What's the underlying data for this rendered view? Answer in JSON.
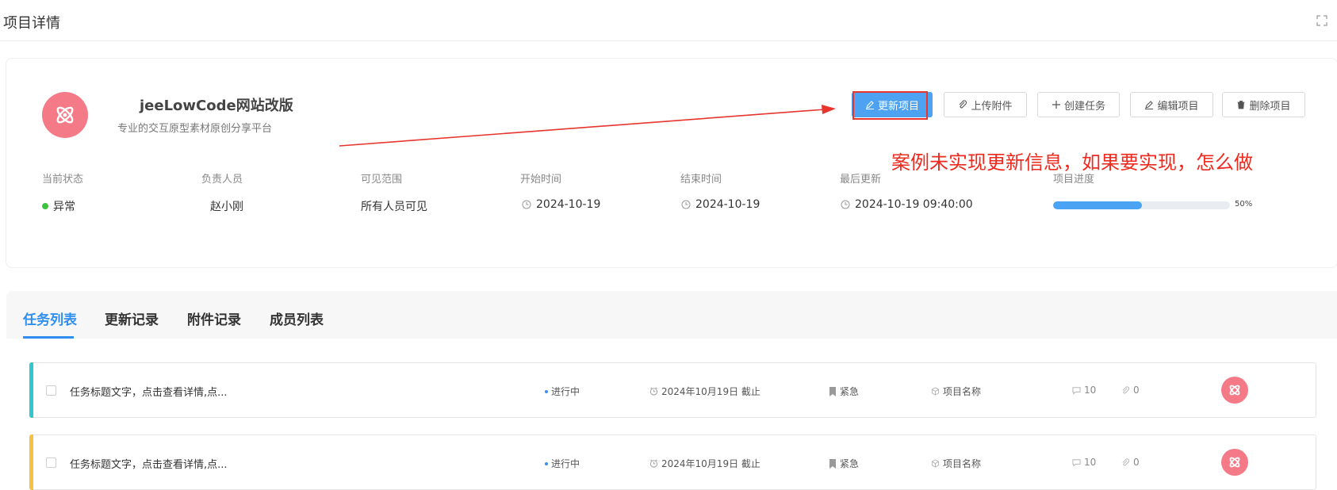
{
  "header": {
    "title": "项目详情",
    "fullscreen_icon": "fullscreen-icon"
  },
  "project": {
    "logo_icon": "atom-icon",
    "name": "jeeLowCode网站改版",
    "description": "专业的交互原型素材原创分享平台",
    "logo_color": "#f47a87"
  },
  "actions": [
    {
      "label": "更新项目",
      "icon": "pencil-icon"
    },
    {
      "label": "上传附件",
      "icon": "paperclip-icon"
    },
    {
      "label": "创建任务",
      "icon": "plus-icon"
    },
    {
      "label": "编辑项目",
      "icon": "pencil-icon"
    },
    {
      "label": "删除项目",
      "icon": "trash-icon"
    }
  ],
  "annotation": {
    "text": "案例未实现更新信息，如果要实现，怎么做",
    "color": "#ee2a1f"
  },
  "meta": {
    "status": {
      "label": "当前状态",
      "value": "异常",
      "dot_color": "#3fc23f"
    },
    "owner": {
      "label": "负责人员",
      "value": "赵小刚"
    },
    "visibility": {
      "label": "可见范围",
      "value": "所有人员可见"
    },
    "start": {
      "label": "开始时间",
      "value": "2024-10-19"
    },
    "end": {
      "label": "结束时间",
      "value": "2024-10-19"
    },
    "updated": {
      "label": "最后更新",
      "value": "2024-10-19 09:40:00"
    },
    "progress": {
      "label": "项目进度",
      "value": 50,
      "text": "50%"
    }
  },
  "tabs": [
    {
      "label": "任务列表",
      "active": true
    },
    {
      "label": "更新记录",
      "active": false
    },
    {
      "label": "附件记录",
      "active": false
    },
    {
      "label": "成员列表",
      "active": false
    }
  ],
  "tasks": [
    {
      "title": "任务标题文字，点击查看详情,点...",
      "status": "进行中",
      "deadline": "2024年10月19日 截止",
      "priority": "紧急",
      "project": "项目名称",
      "comments": "10",
      "attachments": "0",
      "accent_color": "#2ec9cf"
    },
    {
      "title": "任务标题文字，点击查看详情,点...",
      "status": "进行中",
      "deadline": "2024年10月19日 截止",
      "priority": "紧急",
      "project": "项目名称",
      "comments": "10",
      "attachments": "0",
      "accent_color": "#f6c142"
    }
  ],
  "colors": {
    "primary": "#4da3f2",
    "tab_active": "#2f8ff0",
    "progress": "#4aa3f3"
  }
}
